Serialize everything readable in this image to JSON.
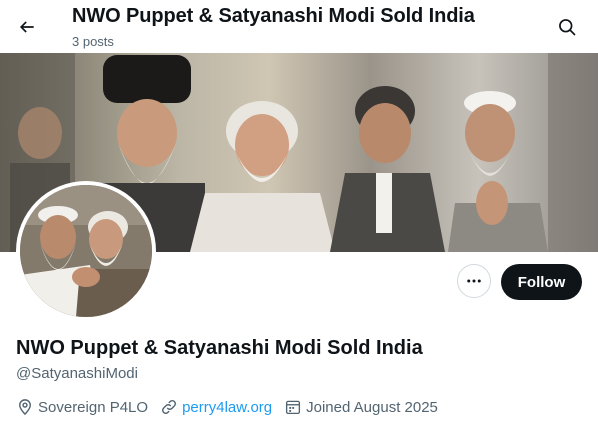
{
  "header": {
    "title": "NWO Puppet & Satyanashi Modi Sold India",
    "posts_count": "3 posts"
  },
  "icons": {
    "back": "arrow-left-icon",
    "search": "search-icon",
    "more": "more-dots-icon",
    "location": "location-pin-icon",
    "link": "link-icon",
    "calendar": "calendar-icon"
  },
  "actions": {
    "follow_label": "Follow"
  },
  "profile": {
    "display_name": "NWO Puppet & Satyanashi Modi Sold India",
    "handle": "@SatyanashiModi",
    "location": "Sovereign P4LO",
    "website": "perry4law.org",
    "joined": "Joined August 2025"
  },
  "colors": {
    "text_primary": "#0f1419",
    "text_secondary": "#536471",
    "link": "#1d9bf0",
    "follow_bg": "#0f1419",
    "border": "#cfd9de"
  }
}
